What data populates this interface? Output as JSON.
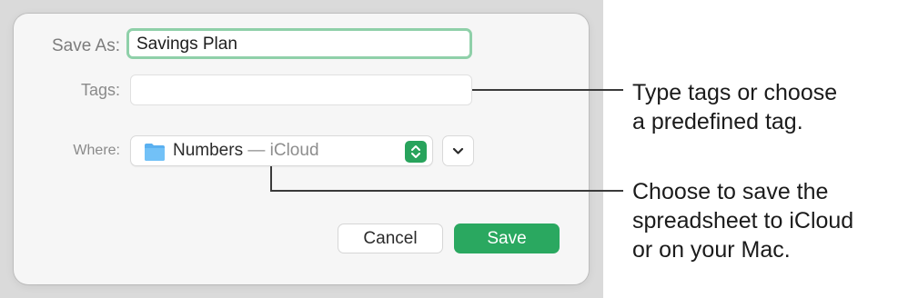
{
  "dialog": {
    "save_as_label": "Save As:",
    "save_as_value": "Savings Plan",
    "tags_label": "Tags:",
    "tags_value": "",
    "where_label": "Where:",
    "where_location": "Numbers",
    "where_separator": " — ",
    "where_service": "iCloud",
    "cancel_label": "Cancel",
    "save_label": "Save"
  },
  "callouts": {
    "tags": [
      "Type tags or choose",
      "a predefined tag."
    ],
    "where": [
      "Choose to save the",
      "spreadsheet to iCloud",
      "or on your Mac."
    ]
  },
  "icons": {
    "folder": "folder-icon",
    "stepper": "up-down-chevron-icon",
    "expand": "chevron-down-icon"
  },
  "colors": {
    "accent": "#2aa860",
    "focus_ring": "#8fd0a9",
    "folder_blue": "#5ab0f0"
  }
}
